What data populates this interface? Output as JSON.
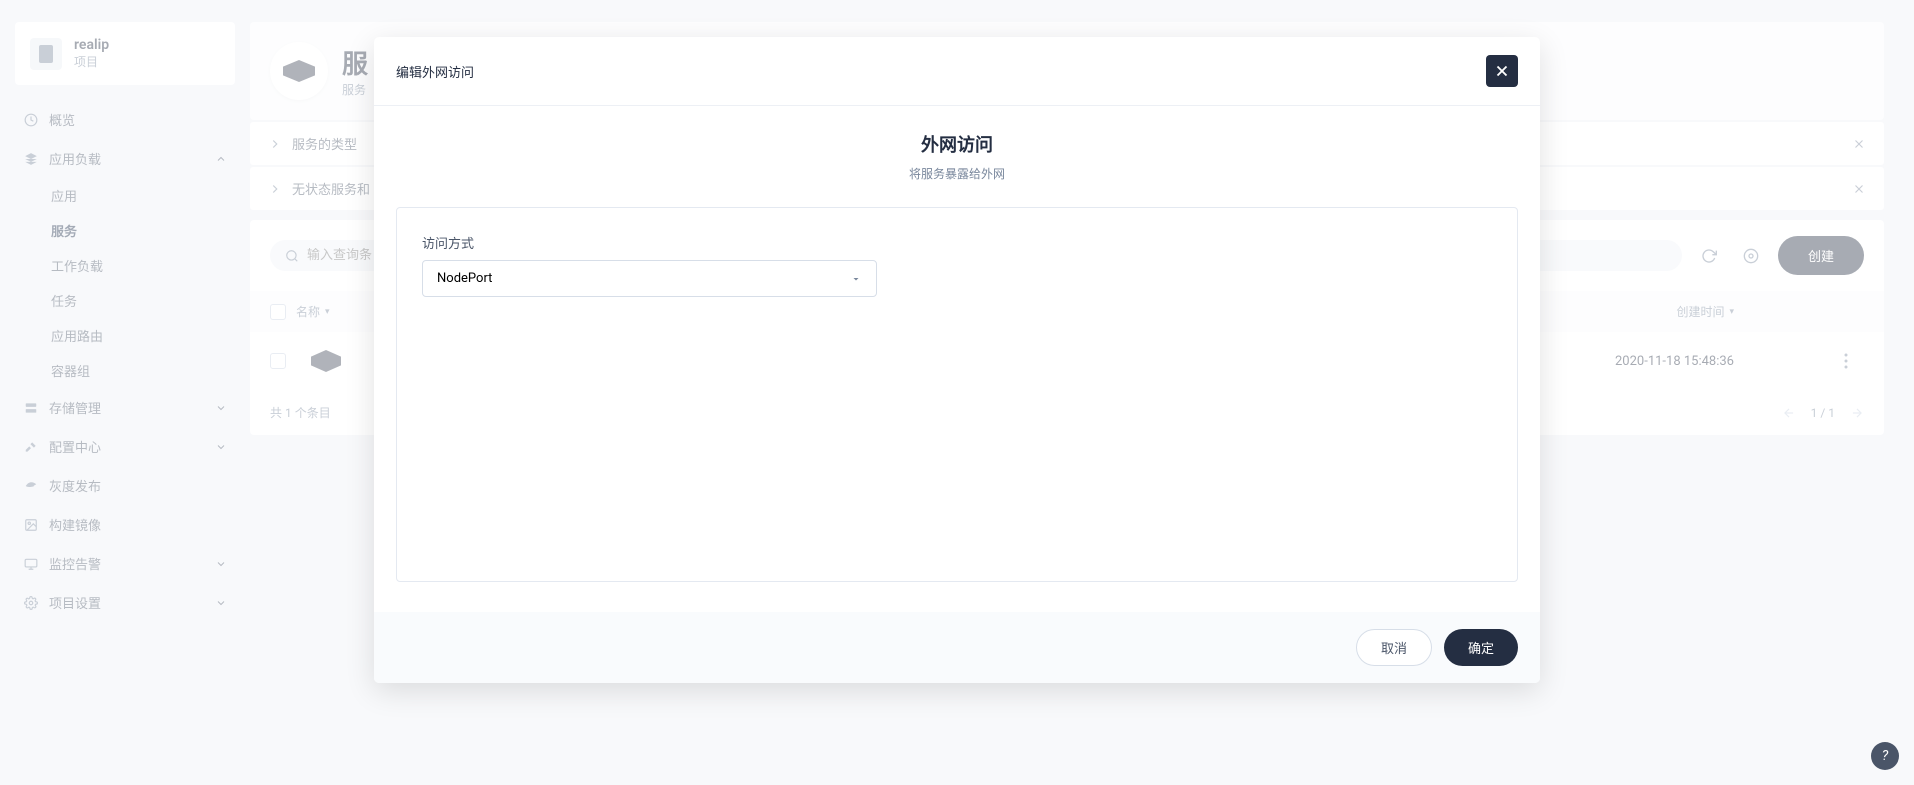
{
  "project": {
    "name": "realip",
    "subtitle": "项目"
  },
  "sidebar": {
    "overview": "概览",
    "app_load": {
      "label": "应用负载",
      "open": true,
      "items": [
        "应用",
        "服务",
        "工作负载",
        "任务",
        "应用路由",
        "容器组"
      ],
      "active_index": 1
    },
    "storage": "存储管理",
    "config": "配置中心",
    "gray": "灰度发布",
    "build": "构建镜像",
    "monitor": "监控告警",
    "project_settings": "项目设置"
  },
  "page": {
    "title": "服",
    "desc": "服务",
    "tip1": "服务的类型",
    "tip2": "无状态服务和",
    "search_placeholder": "输入查询条",
    "create": "创建",
    "col_name": "名称",
    "col_time": "创建时间",
    "row_time": "2020-11-18 15:48:36",
    "footer_total": "共 1 个条目",
    "page_info": "1 / 1"
  },
  "modal": {
    "title": "编辑外网访问",
    "heading": "外网访问",
    "subtitle": "将服务暴露给外网",
    "form_label": "访问方式",
    "select_value": "NodePort",
    "cancel": "取消",
    "confirm": "确定"
  },
  "help": "?"
}
